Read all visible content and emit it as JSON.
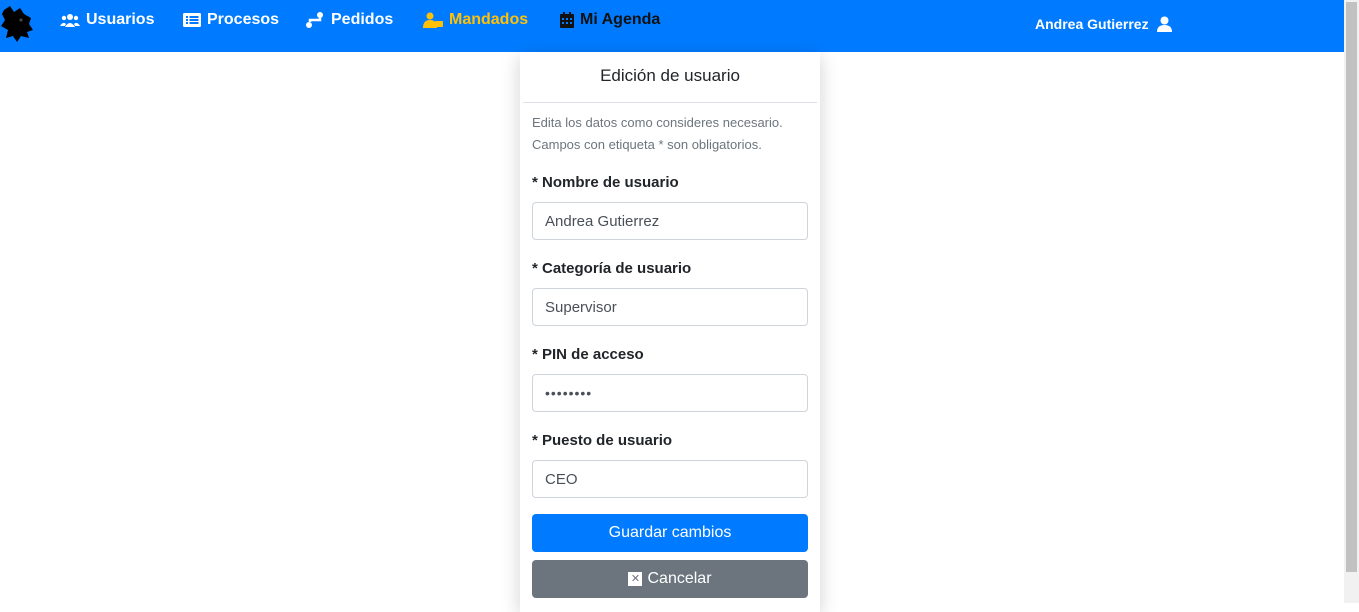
{
  "navbar": {
    "brand_logo": "wolf-head-logo",
    "items": [
      {
        "label": "Usuarios",
        "icon": "users-icon"
      },
      {
        "label": "Procesos",
        "icon": "list-icon"
      },
      {
        "label": "Pedidos",
        "icon": "route-icon"
      },
      {
        "label": "Mandados",
        "icon": "errand-icon",
        "active": true
      },
      {
        "label": "Mi Agenda",
        "icon": "calendar-icon"
      }
    ],
    "user_name": "Andrea Gutierrez",
    "user_icon": "user-icon",
    "colors": {
      "background": "#007bff",
      "active": "#ffc107",
      "agenda": "#111111"
    }
  },
  "form": {
    "title": "Edición de usuario",
    "help_line1": "Edita los datos como consideres necesario.",
    "help_line2": "Campos con etiqueta * son obligatorios.",
    "fields": [
      {
        "label": "* Nombre de usuario",
        "value": "Andrea Gutierrez"
      },
      {
        "label": "* Categoría de usuario",
        "value": "Supervisor"
      },
      {
        "label": "* PIN de acceso",
        "value": "••••••••"
      },
      {
        "label": "* Puesto de usuario",
        "value": "CEO"
      }
    ],
    "save_label": "Guardar cambios",
    "cancel_label": "Cancelar",
    "cancel_icon": "close-square-icon",
    "colors": {
      "primary": "#007bff",
      "secondary": "#6c757d"
    }
  }
}
